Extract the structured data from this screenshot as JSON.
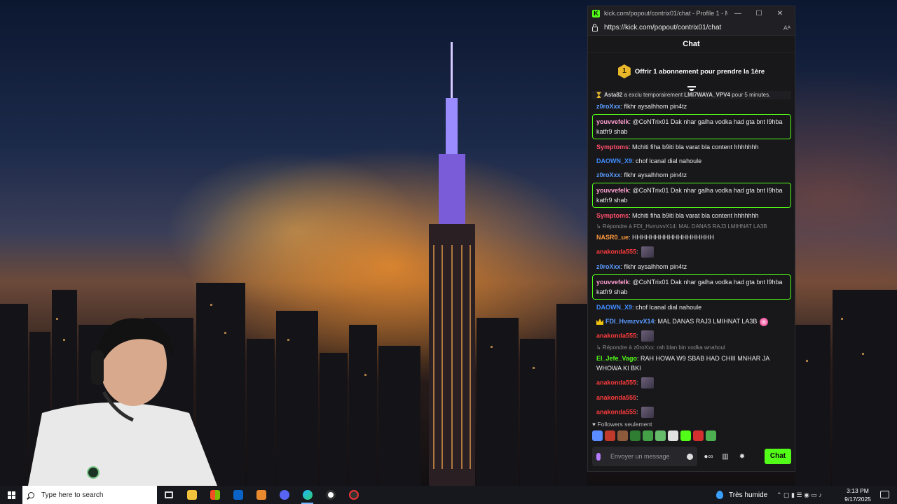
{
  "browser": {
    "window_title": "kick.com/popout/contrix01/chat - Profile 1 - Micros...",
    "url": "https://kick.com/popout/contrix01/chat",
    "min_glyph": "—",
    "max_glyph": "☐",
    "close_glyph": "✕",
    "readaloud_glyph": "Aᴬ"
  },
  "chat": {
    "header": "Chat",
    "pinned_coin": "1",
    "pinned_text": "Offrir 1 abonnement pour prendre la 1ère",
    "system_user": "Asta82",
    "system_text": " a exclu temporairement ",
    "system_target": "LMI7WAYA_VPV4",
    "system_tail": " pour 5 minutes.",
    "messages": [
      {
        "user": "z0roXxx",
        "text": ": flkhr aysalhhom pin4tz",
        "color": "#5b9cff"
      },
      {
        "user": "youvvefelk",
        "text": ": @CoNTrix01 Dak nhar galha vodka had gta bnt l9hba katfr9 shab",
        "color": "#ff9fd0"
      },
      {
        "user": "Symptoms",
        "text": ": Mchiti fiha b9iti bla varat bla content hhhhhhh",
        "color": "#ff4f6b"
      },
      {
        "user": "DAOWN_X9",
        "text": ": chof lcanal dial nahoule",
        "color": "#3f8cff"
      },
      {
        "user": "z0roXxx",
        "text": ": flkhr aysalhhom pin4tz",
        "color": "#5b9cff"
      },
      {
        "user": "youvvefelk",
        "text": ": @CoNTrix01 Dak nhar galha vodka had gta bnt l9hba katfr9 shab",
        "color": "#ff9fd0"
      },
      {
        "user": "Symptoms",
        "text": ": Mchiti fiha b9iti bla varat bla content hhhhhhh",
        "color": "#ff4f6b"
      },
      {
        "reply": "↳ Répondre à FDI_HvmzvvX14: MAL DANAS RAJ3 LMIHNAT LA3B"
      },
      {
        "user": "NASR0_ue",
        "text": ": HHHHHHHHHHHHHHHHHH",
        "color": "#ff9a3c"
      },
      {
        "user": "anakonda555",
        "text": ":",
        "color": "#ff3b3b",
        "emote": "emote-1"
      },
      {
        "user": "z0roXxx",
        "text": ": flkhr aysalhhom pin4tz",
        "color": "#5b9cff"
      },
      {
        "user": "youvvefelk",
        "text": ": @CoNTrix01 Dak nhar galha vodka had gta bnt l9hba katfr9 shab",
        "color": "#ff9fd0"
      },
      {
        "user": "DAOWN_X9",
        "text": ": chof lcanal dial nahoule",
        "color": "#3f8cff"
      },
      {
        "user": "FDI_HvmzvvX14",
        "text": ": MAL DANAS RAJ3 LMIHNAT LA3B",
        "color": "#5b9cff",
        "emote": "pink-emote"
      },
      {
        "user": "anakonda555",
        "text": ":",
        "color": "#ff3b3b",
        "emote": "emote-2"
      },
      {
        "reply": "↳ Répondre à z0roXxx: rah blan bin vodka wnahoul"
      },
      {
        "user": "El_Jefe_Vago",
        "text": ": RAH HOWA W9 SBAB HAD CHIII MNHAR JA WHOWA KI BKI",
        "color": "#53fc18"
      },
      {
        "user": "anakonda555",
        "text": ":",
        "color": "#ff3b3b",
        "emote": "emote-3"
      },
      {
        "user": "anakonda555",
        "text": ":",
        "color": "#ff3b3b"
      },
      {
        "user": "anakonda555",
        "text": ":",
        "color": "#ff3b3b",
        "emote": "emote-4"
      }
    ],
    "followers_label": "♥ Followers seulement",
    "input_placeholder": "Envoyer un message",
    "send_label": "Chat"
  },
  "taskbar": {
    "search_placeholder": "Type here to search",
    "weather": "Très humide",
    "time": "3:13 PM",
    "date": "9/17/2025",
    "tray_glyphs": "⌃ ▢ ▮ ☰ ◉ ▭ ♪"
  },
  "colors": {
    "kick_green": "#53fc18",
    "highlight": "#53fc18"
  }
}
